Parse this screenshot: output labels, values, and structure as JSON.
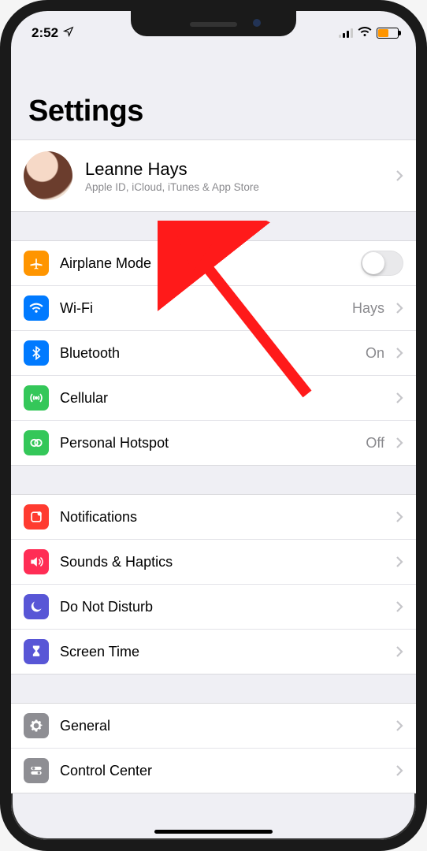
{
  "status": {
    "time": "2:52"
  },
  "title": "Settings",
  "profile": {
    "name": "Leanne Hays",
    "subtitle": "Apple ID, iCloud, iTunes & App Store"
  },
  "groups": [
    {
      "rows": [
        {
          "icon": "airplane",
          "color": "orange",
          "label": "Airplane Mode",
          "control": "toggle",
          "toggle": false
        },
        {
          "icon": "wifi",
          "color": "blue",
          "label": "Wi-Fi",
          "value": "Hays",
          "chevron": true
        },
        {
          "icon": "bluetooth",
          "color": "blue",
          "label": "Bluetooth",
          "value": "On",
          "chevron": true
        },
        {
          "icon": "cellular",
          "color": "green",
          "label": "Cellular",
          "chevron": true
        },
        {
          "icon": "hotspot",
          "color": "green",
          "label": "Personal Hotspot",
          "value": "Off",
          "chevron": true
        }
      ]
    },
    {
      "rows": [
        {
          "icon": "notifications",
          "color": "red",
          "label": "Notifications",
          "chevron": true
        },
        {
          "icon": "sounds",
          "color": "pink",
          "label": "Sounds & Haptics",
          "chevron": true
        },
        {
          "icon": "moon",
          "color": "purple",
          "label": "Do Not Disturb",
          "chevron": true
        },
        {
          "icon": "hourglass",
          "color": "purple",
          "label": "Screen Time",
          "chevron": true
        }
      ]
    },
    {
      "rows": [
        {
          "icon": "gear",
          "color": "gray",
          "label": "General",
          "chevron": true
        },
        {
          "icon": "toggles",
          "color": "gray",
          "label": "Control Center",
          "chevron": true
        }
      ]
    }
  ],
  "annotation": {
    "type": "red-arrow",
    "points_to": "profile-row"
  }
}
